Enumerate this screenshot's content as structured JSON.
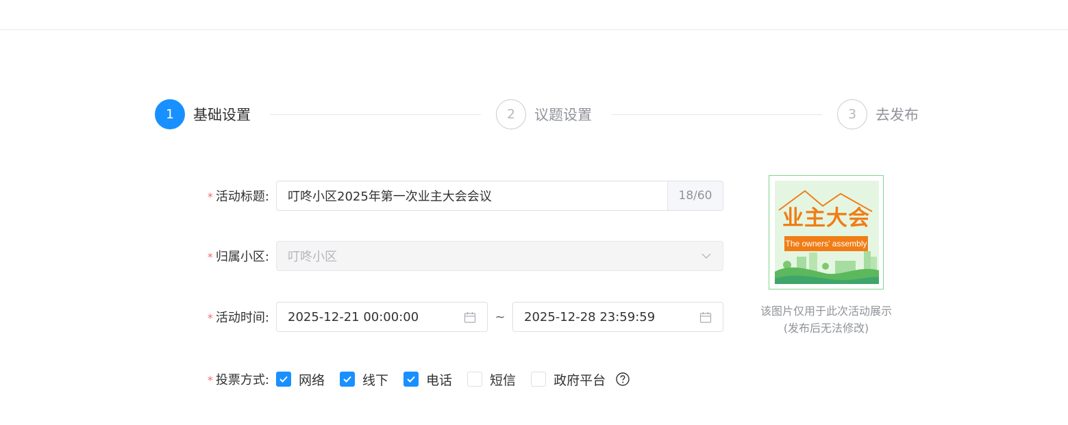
{
  "steps": [
    {
      "number": "1",
      "title": "基础设置",
      "state": "active"
    },
    {
      "number": "2",
      "title": "议题设置",
      "state": "inactive"
    },
    {
      "number": "3",
      "title": "去发布",
      "state": "inactive"
    }
  ],
  "form": {
    "title": {
      "label": "活动标题:",
      "value": "叮咚小区2025年第一次业主大会会议",
      "count": "18/60"
    },
    "community": {
      "label": "归属小区:",
      "value": "叮咚小区"
    },
    "time": {
      "label": "活动时间:",
      "start": "2025-12-21 00:00:00",
      "separator": "~",
      "end": "2025-12-28 23:59:59"
    },
    "voting": {
      "label": "投票方式:",
      "options": [
        {
          "label": "网络",
          "checked": true
        },
        {
          "label": "线下",
          "checked": true
        },
        {
          "label": "电话",
          "checked": true
        },
        {
          "label": "短信",
          "checked": false
        },
        {
          "label": "政府平台",
          "checked": false
        }
      ]
    },
    "required_mark": "*"
  },
  "cover": {
    "title_cn": "业主大会",
    "title_en": "The owners' assembly",
    "note_line1": "该图片仅用于此次活动展示",
    "note_line2": "(发布后无法修改)"
  },
  "colors": {
    "primary": "#1890ff",
    "required": "#f56c6c",
    "cover_orange": "#f07d16",
    "cover_green": "#5cb85c"
  }
}
